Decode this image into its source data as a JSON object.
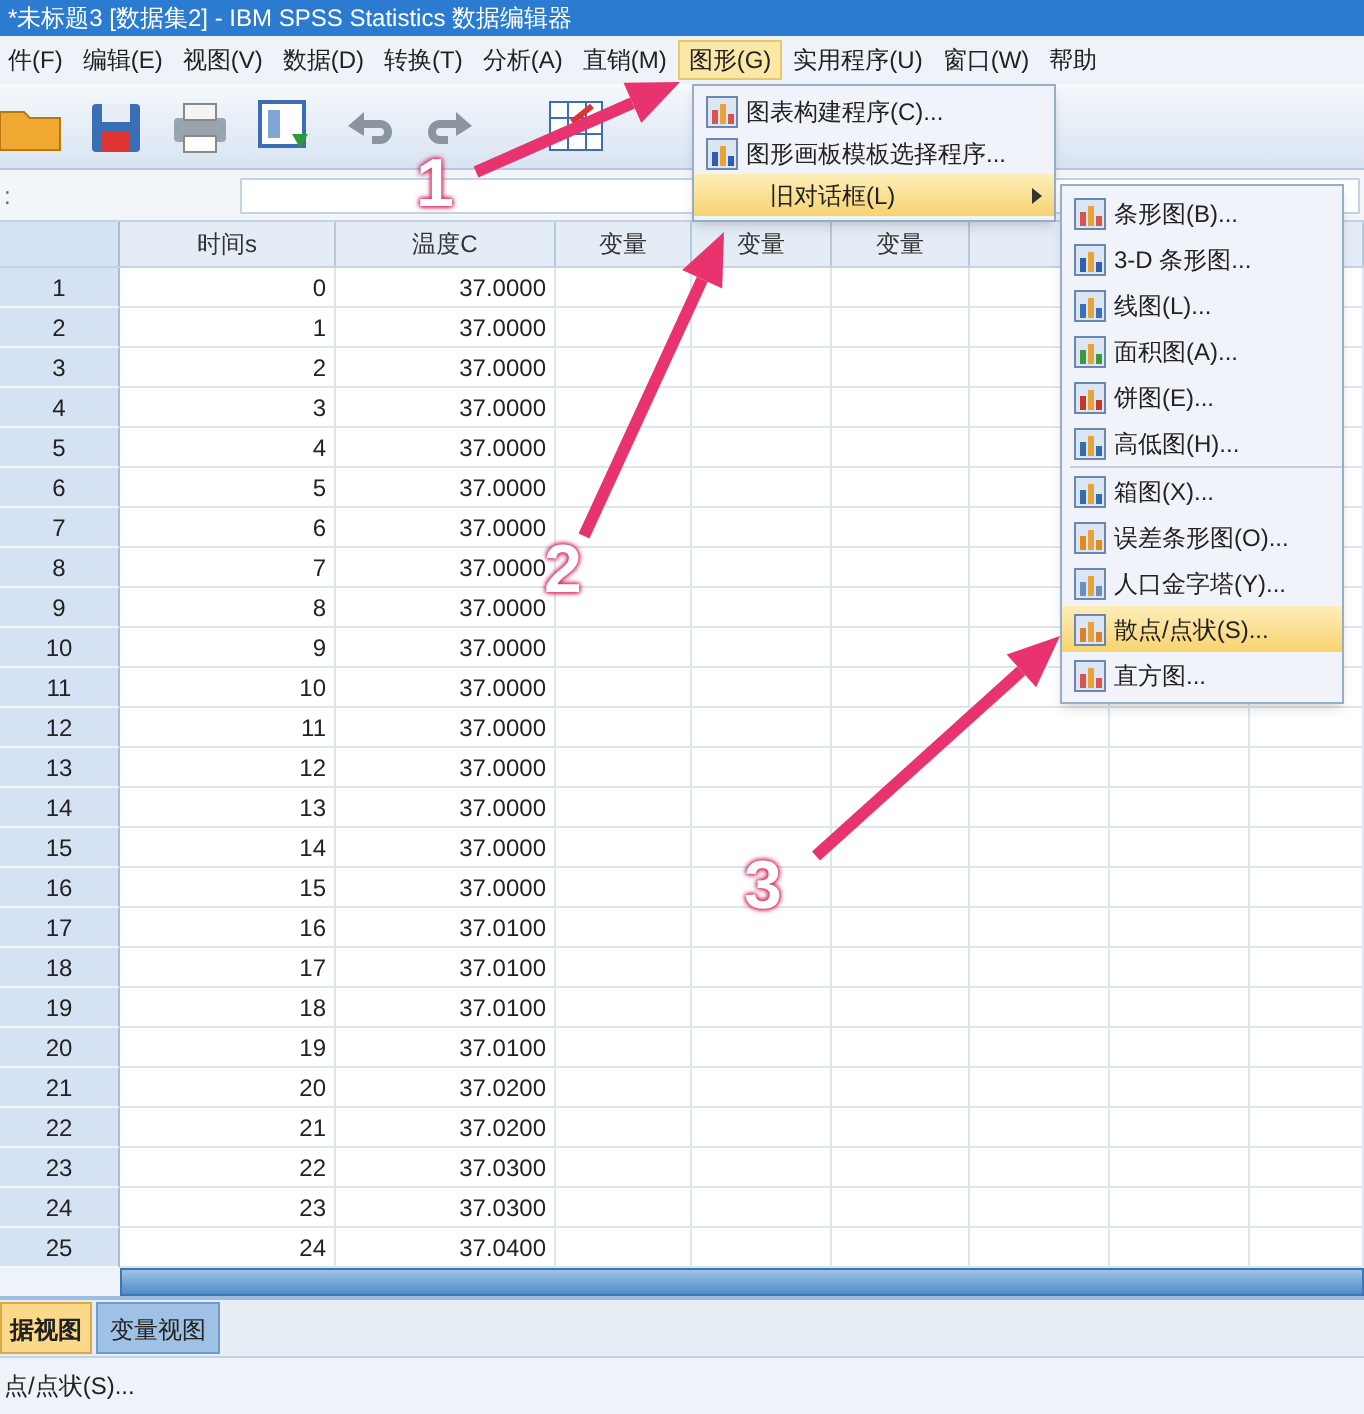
{
  "window": {
    "title": "*未标题3 [数据集2] - IBM SPSS Statistics 数据编辑器"
  },
  "menu_bar": [
    {
      "label": "件(F)",
      "selected": false
    },
    {
      "label": "编辑(E)",
      "selected": false
    },
    {
      "label": "视图(V)",
      "selected": false
    },
    {
      "label": "数据(D)",
      "selected": false
    },
    {
      "label": "转换(T)",
      "selected": false
    },
    {
      "label": "分析(A)",
      "selected": false
    },
    {
      "label": "直销(M)",
      "selected": false
    },
    {
      "label": "图形(G)",
      "selected": true
    },
    {
      "label": "实用程序(U)",
      "selected": false
    },
    {
      "label": "窗口(W)",
      "selected": false
    },
    {
      "label": "帮助",
      "selected": false
    }
  ],
  "cell_editor": {
    "label": ":"
  },
  "graph_menu": [
    {
      "label": "图表构建程序(C)...",
      "selected": false,
      "submenu": false
    },
    {
      "label": "图形画板模板选择程序...",
      "selected": false,
      "submenu": false
    },
    {
      "label": "旧对话框(L)",
      "selected": true,
      "submenu": true
    }
  ],
  "legacy_submenu": [
    {
      "kind": "item",
      "label": "条形图(B)...",
      "selected": false
    },
    {
      "kind": "item",
      "label": "3-D 条形图...",
      "selected": false
    },
    {
      "kind": "item",
      "label": "线图(L)...",
      "selected": false
    },
    {
      "kind": "item",
      "label": "面积图(A)...",
      "selected": false
    },
    {
      "kind": "item",
      "label": "饼图(E)...",
      "selected": false
    },
    {
      "kind": "item",
      "label": "高低图(H)...",
      "selected": false
    },
    {
      "kind": "separator"
    },
    {
      "kind": "item",
      "label": "箱图(X)...",
      "selected": false
    },
    {
      "kind": "item",
      "label": "误差条形图(O)...",
      "selected": false
    },
    {
      "kind": "item",
      "label": "人口金字塔(Y)...",
      "selected": false
    },
    {
      "kind": "item",
      "label": "散点/点状(S)...",
      "selected": true
    },
    {
      "kind": "item",
      "label": "直方图...",
      "selected": false
    }
  ],
  "table": {
    "columns": [
      "时间s",
      "温度C",
      "变量",
      "变量",
      "变量"
    ],
    "rows": [
      {
        "num": "1",
        "cells": [
          "0",
          "37.0000"
        ]
      },
      {
        "num": "2",
        "cells": [
          "1",
          "37.0000"
        ]
      },
      {
        "num": "3",
        "cells": [
          "2",
          "37.0000"
        ]
      },
      {
        "num": "4",
        "cells": [
          "3",
          "37.0000"
        ]
      },
      {
        "num": "5",
        "cells": [
          "4",
          "37.0000"
        ]
      },
      {
        "num": "6",
        "cells": [
          "5",
          "37.0000"
        ]
      },
      {
        "num": "7",
        "cells": [
          "6",
          "37.0000"
        ]
      },
      {
        "num": "8",
        "cells": [
          "7",
          "37.0000"
        ]
      },
      {
        "num": "9",
        "cells": [
          "8",
          "37.0000"
        ]
      },
      {
        "num": "10",
        "cells": [
          "9",
          "37.0000"
        ]
      },
      {
        "num": "11",
        "cells": [
          "10",
          "37.0000"
        ]
      },
      {
        "num": "12",
        "cells": [
          "11",
          "37.0000"
        ]
      },
      {
        "num": "13",
        "cells": [
          "12",
          "37.0000"
        ]
      },
      {
        "num": "14",
        "cells": [
          "13",
          "37.0000"
        ]
      },
      {
        "num": "15",
        "cells": [
          "14",
          "37.0000"
        ]
      },
      {
        "num": "16",
        "cells": [
          "15",
          "37.0000"
        ]
      },
      {
        "num": "17",
        "cells": [
          "16",
          "37.0100"
        ]
      },
      {
        "num": "18",
        "cells": [
          "17",
          "37.0100"
        ]
      },
      {
        "num": "19",
        "cells": [
          "18",
          "37.0100"
        ]
      },
      {
        "num": "20",
        "cells": [
          "19",
          "37.0100"
        ]
      },
      {
        "num": "21",
        "cells": [
          "20",
          "37.0200"
        ]
      },
      {
        "num": "22",
        "cells": [
          "21",
          "37.0200"
        ]
      },
      {
        "num": "23",
        "cells": [
          "22",
          "37.0300"
        ]
      },
      {
        "num": "24",
        "cells": [
          "23",
          "37.0300"
        ]
      },
      {
        "num": "25",
        "cells": [
          "24",
          "37.0400"
        ]
      }
    ]
  },
  "view_tabs": [
    {
      "label": "据视图",
      "selected": true
    },
    {
      "label": "变量视图",
      "selected": false
    }
  ],
  "status_bar": {
    "text": "点/点状(S)..."
  },
  "annotations": [
    {
      "label": "1"
    },
    {
      "label": "2"
    },
    {
      "label": "3"
    }
  ]
}
